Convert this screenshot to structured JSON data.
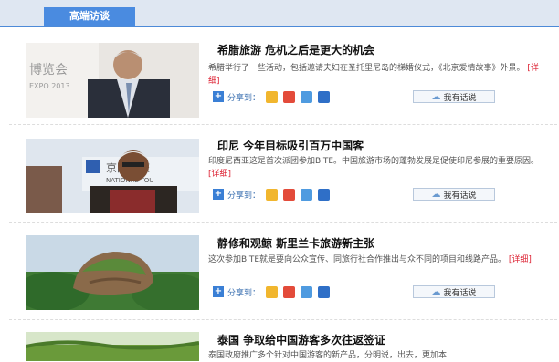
{
  "header": {
    "tab_label": "高端访谈"
  },
  "articles": [
    {
      "title": "希腊旅游 危机之后是更大的机会",
      "desc": "希腊举行了一些活动，包括邀请夫妇在圣托里尼岛的梯婚仪式，《北京爱情故事》外景。",
      "detail": "[详细]",
      "photo_text_1": "博览会",
      "photo_text_2": "EXPO 2013"
    },
    {
      "title": "印尼 今年目标吸引百万中国客",
      "desc": "印度尼西亚这是首次派团参加BITE。中国旅游市场的蓬勃发展是促使印尼参展的重要原因。",
      "detail": "[详细]",
      "photo_text_1": "京国际旅",
      "photo_text_2": "NATIONAL TOU"
    },
    {
      "title": "静修和观鲸 斯里兰卡旅游新主张",
      "desc": "这次参加BITE就是要向公众宣传、同旅行社合作推出与众不同的项目和线路产品。",
      "detail": "[详细]"
    },
    {
      "title": "泰国 争取给中国游客多次往返签证",
      "desc": "泰国政府推广多个针对中国游客的新产品，分明说，出去，更加本"
    }
  ],
  "share": {
    "label": "分享到：",
    "plus": "+"
  },
  "comment": {
    "label": "我有话说",
    "icon": "speech-bubble-icon"
  },
  "colors": {
    "accent": "#4a8be0",
    "detail": "#d22233"
  }
}
